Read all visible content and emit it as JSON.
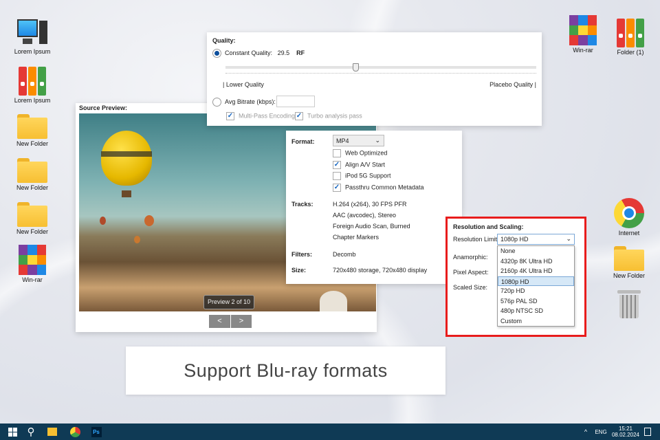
{
  "desktop": {
    "left_icons": [
      "Lorem Ipsum",
      "Lorem Ipsum",
      "New Folder",
      "New Folder",
      "New Folder",
      "Win-rar"
    ],
    "right_icons": [
      "Win-rar",
      "Folder (1)",
      "Internet",
      "New Folder"
    ]
  },
  "quality": {
    "title": "Quality:",
    "constant_label": "Constant Quality:",
    "value": "29.5",
    "unit": "RF",
    "slider_fraction": 0.42,
    "lower": "| Lower Quality",
    "placebo": "Placebo Quality |",
    "avg_label": "Avg Bitrate (kbps):",
    "avg_value": "",
    "multipass": "Multi-Pass Encoding",
    "turbo": "Turbo analysis pass"
  },
  "preview": {
    "title": "Source Preview:",
    "counter": "Preview 2 of 10",
    "prev": "<",
    "next": ">"
  },
  "summary": {
    "format_label": "Format:",
    "format_value": "MP4",
    "options": [
      {
        "label": "Web Optimized",
        "checked": false
      },
      {
        "label": "Align A/V Start",
        "checked": true
      },
      {
        "label": "iPod 5G Support",
        "checked": false
      },
      {
        "label": "Passthru Common Metadata",
        "checked": true
      }
    ],
    "tracks_label": "Tracks:",
    "tracks": [
      "H.264 (x264), 30 FPS PFR",
      "AAC (avcodec), Stereo",
      "Foreign Audio Scan, Burned",
      "Chapter Markers"
    ],
    "filters_label": "Filters:",
    "filters": "Decomb",
    "size_label": "Size:",
    "size": "720x480 storage, 720x480 display"
  },
  "resolution": {
    "title": "Resolution and Scaling:",
    "limit_label": "Resolution Limit:",
    "limit_value": "1080p HD",
    "anamorphic": "Anamorphic:",
    "pixel_aspect": "Pixel Aspect:",
    "scaled_size": "Scaled Size:",
    "options": [
      "None",
      "4320p 8K Ultra HD",
      "2160p 4K Ultra HD",
      "1080p HD",
      "720p HD",
      "576p PAL SD",
      "480p NTSC SD",
      "Custom"
    ],
    "selected": 3
  },
  "banner": "Support Blu-ray formats",
  "taskbar": {
    "lang": "ENG",
    "time": "15:21",
    "date": "08.02.2024"
  },
  "colors": {
    "accent": "#0d4f9c",
    "highlight": "#e33",
    "taskbar": "#0f3a55"
  }
}
